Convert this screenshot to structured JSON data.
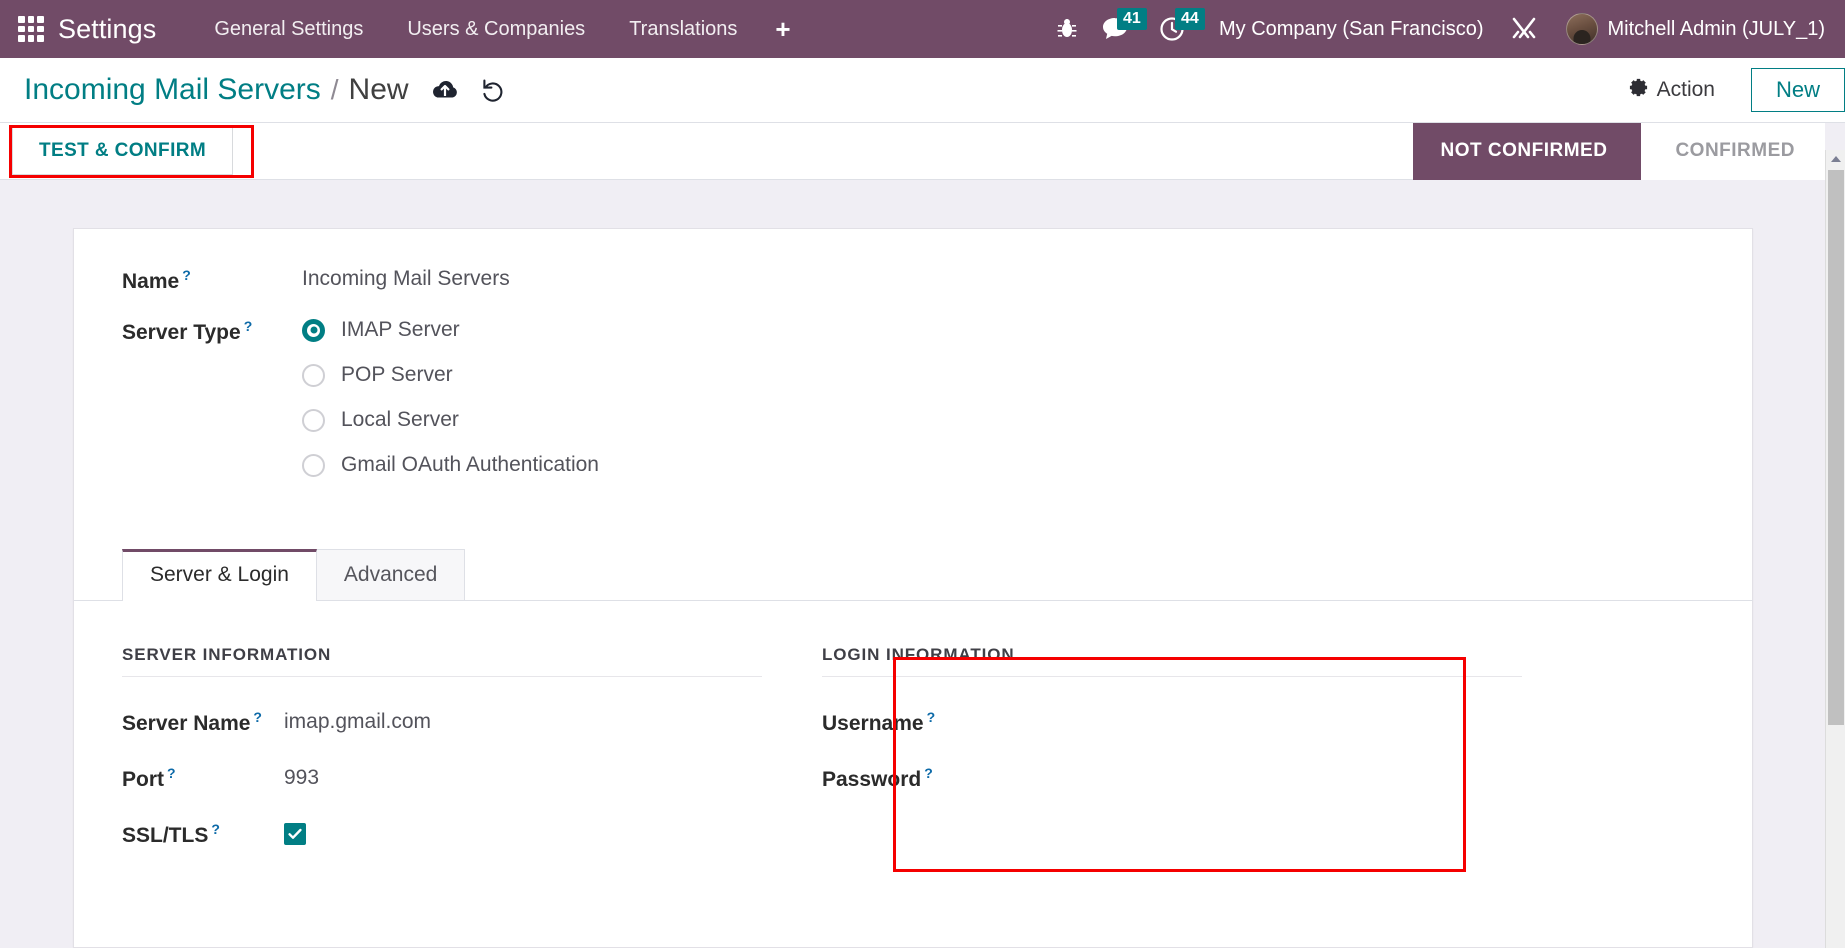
{
  "navbar": {
    "apps_icon": "apps-grid-icon",
    "brand": "Settings",
    "menu": [
      {
        "label": "General Settings"
      },
      {
        "label": "Users & Companies"
      },
      {
        "label": "Translations"
      }
    ],
    "plus_label": "+",
    "debug_icon": "bug-icon",
    "messages": {
      "icon": "chat-bubble-icon",
      "count": "41"
    },
    "activities": {
      "icon": "clock-icon",
      "count": "44"
    },
    "company": "My Company (San Francisco)",
    "tools_icon": "wrench-screwdriver-icon",
    "avatar": "user-avatar",
    "user": "Mitchell Admin (JULY_1)",
    "accent": "#714B67",
    "badge_color": "#017e84"
  },
  "control_panel": {
    "breadcrumb_parent": "Incoming Mail Servers",
    "breadcrumb_separator": "/",
    "breadcrumb_current": "New",
    "save_icon": "cloud-upload-icon",
    "discard_icon": "undo-icon",
    "action_label": "Action",
    "action_icon": "gear-icon",
    "new_label": "New",
    "accent": "#017e84"
  },
  "status_bar": {
    "test_confirm_label": "TEST & CONFIRM",
    "stages": [
      {
        "label": "NOT CONFIRMED",
        "active": true
      },
      {
        "label": "CONFIRMED",
        "active": false
      }
    ]
  },
  "form": {
    "name": {
      "label": "Name",
      "tooltip": "?",
      "value": "Incoming Mail Servers"
    },
    "server_type": {
      "label": "Server Type",
      "tooltip": "?",
      "options": [
        {
          "label": "IMAP Server",
          "selected": true
        },
        {
          "label": "POP Server",
          "selected": false
        },
        {
          "label": "Local Server",
          "selected": false
        },
        {
          "label": "Gmail OAuth Authentication",
          "selected": false
        }
      ]
    },
    "tabs": [
      {
        "label": "Server & Login",
        "active": true
      },
      {
        "label": "Advanced",
        "active": false
      }
    ],
    "server_information": {
      "title": "SERVER INFORMATION",
      "fields": [
        {
          "label": "Server Name",
          "tooltip": "?",
          "value": "imap.gmail.com",
          "type": "text"
        },
        {
          "label": "Port",
          "tooltip": "?",
          "value": "993",
          "type": "text"
        },
        {
          "label": "SSL/TLS",
          "tooltip": "?",
          "value": "",
          "type": "checkbox",
          "checked": true
        }
      ]
    },
    "login_information": {
      "title": "LOGIN INFORMATION",
      "fields": [
        {
          "label": "Username",
          "tooltip": "?",
          "value": "",
          "type": "text"
        },
        {
          "label": "Password",
          "tooltip": "?",
          "value": "",
          "type": "text"
        }
      ]
    }
  },
  "annotations": {
    "color": "#f50000",
    "boxes": [
      {
        "name": "test-and-confirm-highlight"
      },
      {
        "name": "login-information-highlight"
      }
    ]
  },
  "scrollbar": {
    "up_arrow": "scroll-up-arrow"
  }
}
